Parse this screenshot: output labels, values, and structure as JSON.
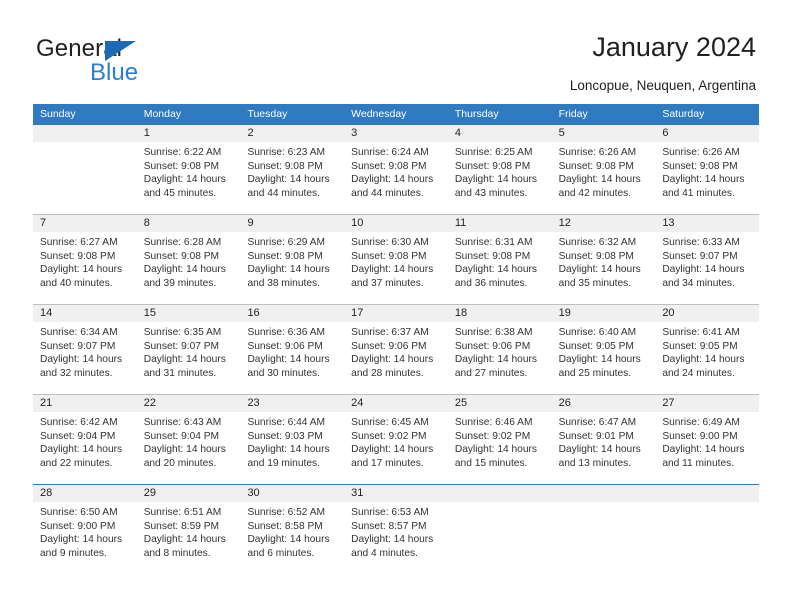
{
  "brand": {
    "name_part1": "General",
    "name_part2": "Blue",
    "accent_color": "#2a7fd4",
    "triangle_color": "#1c69b4"
  },
  "header": {
    "title": "January 2024",
    "location": "Loncopue, Neuquen, Argentina"
  },
  "calendar": {
    "header_bg": "#2f7ac0",
    "number_band_bg": "#f0f0f0",
    "weekdays": [
      "Sunday",
      "Monday",
      "Tuesday",
      "Wednesday",
      "Thursday",
      "Friday",
      "Saturday"
    ],
    "weeks": [
      [
        {
          "day": "",
          "sunrise": "",
          "sunset": "",
          "daylight_line1": "",
          "daylight_line2": ""
        },
        {
          "day": "1",
          "sunrise": "Sunrise: 6:22 AM",
          "sunset": "Sunset: 9:08 PM",
          "daylight_line1": "Daylight: 14 hours",
          "daylight_line2": "and 45 minutes."
        },
        {
          "day": "2",
          "sunrise": "Sunrise: 6:23 AM",
          "sunset": "Sunset: 9:08 PM",
          "daylight_line1": "Daylight: 14 hours",
          "daylight_line2": "and 44 minutes."
        },
        {
          "day": "3",
          "sunrise": "Sunrise: 6:24 AM",
          "sunset": "Sunset: 9:08 PM",
          "daylight_line1": "Daylight: 14 hours",
          "daylight_line2": "and 44 minutes."
        },
        {
          "day": "4",
          "sunrise": "Sunrise: 6:25 AM",
          "sunset": "Sunset: 9:08 PM",
          "daylight_line1": "Daylight: 14 hours",
          "daylight_line2": "and 43 minutes."
        },
        {
          "day": "5",
          "sunrise": "Sunrise: 6:26 AM",
          "sunset": "Sunset: 9:08 PM",
          "daylight_line1": "Daylight: 14 hours",
          "daylight_line2": "and 42 minutes."
        },
        {
          "day": "6",
          "sunrise": "Sunrise: 6:26 AM",
          "sunset": "Sunset: 9:08 PM",
          "daylight_line1": "Daylight: 14 hours",
          "daylight_line2": "and 41 minutes."
        }
      ],
      [
        {
          "day": "7",
          "sunrise": "Sunrise: 6:27 AM",
          "sunset": "Sunset: 9:08 PM",
          "daylight_line1": "Daylight: 14 hours",
          "daylight_line2": "and 40 minutes."
        },
        {
          "day": "8",
          "sunrise": "Sunrise: 6:28 AM",
          "sunset": "Sunset: 9:08 PM",
          "daylight_line1": "Daylight: 14 hours",
          "daylight_line2": "and 39 minutes."
        },
        {
          "day": "9",
          "sunrise": "Sunrise: 6:29 AM",
          "sunset": "Sunset: 9:08 PM",
          "daylight_line1": "Daylight: 14 hours",
          "daylight_line2": "and 38 minutes."
        },
        {
          "day": "10",
          "sunrise": "Sunrise: 6:30 AM",
          "sunset": "Sunset: 9:08 PM",
          "daylight_line1": "Daylight: 14 hours",
          "daylight_line2": "and 37 minutes."
        },
        {
          "day": "11",
          "sunrise": "Sunrise: 6:31 AM",
          "sunset": "Sunset: 9:08 PM",
          "daylight_line1": "Daylight: 14 hours",
          "daylight_line2": "and 36 minutes."
        },
        {
          "day": "12",
          "sunrise": "Sunrise: 6:32 AM",
          "sunset": "Sunset: 9:08 PM",
          "daylight_line1": "Daylight: 14 hours",
          "daylight_line2": "and 35 minutes."
        },
        {
          "day": "13",
          "sunrise": "Sunrise: 6:33 AM",
          "sunset": "Sunset: 9:07 PM",
          "daylight_line1": "Daylight: 14 hours",
          "daylight_line2": "and 34 minutes."
        }
      ],
      [
        {
          "day": "14",
          "sunrise": "Sunrise: 6:34 AM",
          "sunset": "Sunset: 9:07 PM",
          "daylight_line1": "Daylight: 14 hours",
          "daylight_line2": "and 32 minutes."
        },
        {
          "day": "15",
          "sunrise": "Sunrise: 6:35 AM",
          "sunset": "Sunset: 9:07 PM",
          "daylight_line1": "Daylight: 14 hours",
          "daylight_line2": "and 31 minutes."
        },
        {
          "day": "16",
          "sunrise": "Sunrise: 6:36 AM",
          "sunset": "Sunset: 9:06 PM",
          "daylight_line1": "Daylight: 14 hours",
          "daylight_line2": "and 30 minutes."
        },
        {
          "day": "17",
          "sunrise": "Sunrise: 6:37 AM",
          "sunset": "Sunset: 9:06 PM",
          "daylight_line1": "Daylight: 14 hours",
          "daylight_line2": "and 28 minutes."
        },
        {
          "day": "18",
          "sunrise": "Sunrise: 6:38 AM",
          "sunset": "Sunset: 9:06 PM",
          "daylight_line1": "Daylight: 14 hours",
          "daylight_line2": "and 27 minutes."
        },
        {
          "day": "19",
          "sunrise": "Sunrise: 6:40 AM",
          "sunset": "Sunset: 9:05 PM",
          "daylight_line1": "Daylight: 14 hours",
          "daylight_line2": "and 25 minutes."
        },
        {
          "day": "20",
          "sunrise": "Sunrise: 6:41 AM",
          "sunset": "Sunset: 9:05 PM",
          "daylight_line1": "Daylight: 14 hours",
          "daylight_line2": "and 24 minutes."
        }
      ],
      [
        {
          "day": "21",
          "sunrise": "Sunrise: 6:42 AM",
          "sunset": "Sunset: 9:04 PM",
          "daylight_line1": "Daylight: 14 hours",
          "daylight_line2": "and 22 minutes."
        },
        {
          "day": "22",
          "sunrise": "Sunrise: 6:43 AM",
          "sunset": "Sunset: 9:04 PM",
          "daylight_line1": "Daylight: 14 hours",
          "daylight_line2": "and 20 minutes."
        },
        {
          "day": "23",
          "sunrise": "Sunrise: 6:44 AM",
          "sunset": "Sunset: 9:03 PM",
          "daylight_line1": "Daylight: 14 hours",
          "daylight_line2": "and 19 minutes."
        },
        {
          "day": "24",
          "sunrise": "Sunrise: 6:45 AM",
          "sunset": "Sunset: 9:02 PM",
          "daylight_line1": "Daylight: 14 hours",
          "daylight_line2": "and 17 minutes."
        },
        {
          "day": "25",
          "sunrise": "Sunrise: 6:46 AM",
          "sunset": "Sunset: 9:02 PM",
          "daylight_line1": "Daylight: 14 hours",
          "daylight_line2": "and 15 minutes."
        },
        {
          "day": "26",
          "sunrise": "Sunrise: 6:47 AM",
          "sunset": "Sunset: 9:01 PM",
          "daylight_line1": "Daylight: 14 hours",
          "daylight_line2": "and 13 minutes."
        },
        {
          "day": "27",
          "sunrise": "Sunrise: 6:49 AM",
          "sunset": "Sunset: 9:00 PM",
          "daylight_line1": "Daylight: 14 hours",
          "daylight_line2": "and 11 minutes."
        }
      ],
      [
        {
          "day": "28",
          "sunrise": "Sunrise: 6:50 AM",
          "sunset": "Sunset: 9:00 PM",
          "daylight_line1": "Daylight: 14 hours",
          "daylight_line2": "and 9 minutes."
        },
        {
          "day": "29",
          "sunrise": "Sunrise: 6:51 AM",
          "sunset": "Sunset: 8:59 PM",
          "daylight_line1": "Daylight: 14 hours",
          "daylight_line2": "and 8 minutes."
        },
        {
          "day": "30",
          "sunrise": "Sunrise: 6:52 AM",
          "sunset": "Sunset: 8:58 PM",
          "daylight_line1": "Daylight: 14 hours",
          "daylight_line2": "and 6 minutes."
        },
        {
          "day": "31",
          "sunrise": "Sunrise: 6:53 AM",
          "sunset": "Sunset: 8:57 PM",
          "daylight_line1": "Daylight: 14 hours",
          "daylight_line2": "and 4 minutes."
        },
        {
          "day": "",
          "sunrise": "",
          "sunset": "",
          "daylight_line1": "",
          "daylight_line2": ""
        },
        {
          "day": "",
          "sunrise": "",
          "sunset": "",
          "daylight_line1": "",
          "daylight_line2": ""
        },
        {
          "day": "",
          "sunrise": "",
          "sunset": "",
          "daylight_line1": "",
          "daylight_line2": ""
        }
      ]
    ]
  }
}
